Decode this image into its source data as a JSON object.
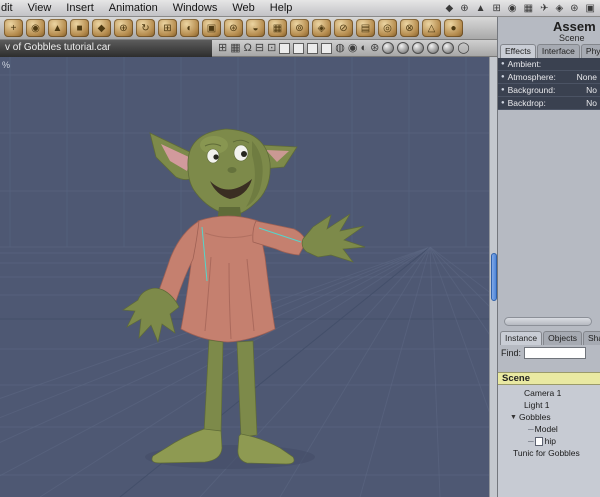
{
  "colors": {
    "viewport_bg": "#4e5873",
    "grid_line": "#5c6884",
    "grid_dark": "#424e68",
    "accent_blue": "#4f86d8",
    "scene_yellow": "#e9e9a2",
    "skin": "#7d8a4a",
    "skin_dark": "#5f6b38",
    "skin_light": "#94a158",
    "ear_pink": "#d79ba0",
    "tunic": "#c5806f",
    "tunic_dark": "#9e6054",
    "feet": "#8e9a52",
    "rig_cyan": "#53d6cc",
    "eye_white": "#f2f2ee",
    "mouth_dark": "#3a2e22"
  },
  "window": {
    "menu_items": [
      "dit",
      "View",
      "Insert",
      "Animation",
      "Windows",
      "Web",
      "Help"
    ],
    "menubar_icons": [
      "◆",
      "⊕",
      "▲",
      "⊞",
      "◉",
      "▦",
      "✈",
      "◈",
      "⊛",
      "▣"
    ]
  },
  "toolbar_main": {
    "icons": [
      "+",
      "◉",
      "▲",
      "■",
      "◆",
      "⊕",
      "↻",
      "⊞",
      "◐",
      "▣",
      "⊛",
      "◒",
      "▦",
      "⊚",
      "◈",
      "⊘",
      "▤",
      "◎",
      "⊗",
      "△",
      "●"
    ]
  },
  "toolbar_view": {
    "glyphs": [
      "⊞",
      "▦",
      "Ω",
      "⊟",
      "⊡"
    ],
    "badges": [
      "◍",
      "◉",
      "◐",
      "⊛"
    ],
    "end_glyph": "◯"
  },
  "title_bar": {
    "text": "v of Gobbles tutorial.car"
  },
  "viewport": {
    "zoom_text": "%"
  },
  "right_panel": {
    "room_label": "Assem",
    "panel_title": "Scene",
    "tabs": [
      {
        "label": "Effects",
        "active": true
      },
      {
        "label": "Interface",
        "active": false
      },
      {
        "label": "Phys",
        "active": false
      }
    ],
    "properties": [
      {
        "bullet": "●",
        "label": "Ambient:",
        "value": ""
      },
      {
        "bullet": "●",
        "label": "Atmosphere:",
        "value": "None"
      },
      {
        "bullet": "●",
        "label": "Background:",
        "value": "No"
      },
      {
        "bullet": "●",
        "label": "Backdrop:",
        "value": "No"
      }
    ],
    "lower_tabs": [
      {
        "label": "Instance",
        "active": true
      },
      {
        "label": "Objects",
        "active": false
      },
      {
        "label": "Shade",
        "active": false
      }
    ],
    "find_label": "Find:",
    "scene_root": "Scene",
    "tree": [
      {
        "label": "Camera 1",
        "indent": 26
      },
      {
        "label": "Light 1",
        "indent": 26
      },
      {
        "label": "Gobbles",
        "indent": 12,
        "expander": "▼"
      },
      {
        "label": "Model",
        "indent": 30,
        "branch": true
      },
      {
        "label": "hip",
        "indent": 30,
        "branch": true,
        "icon": "page"
      },
      {
        "label": "Tunic for Gobbles",
        "indent": 15
      }
    ]
  }
}
